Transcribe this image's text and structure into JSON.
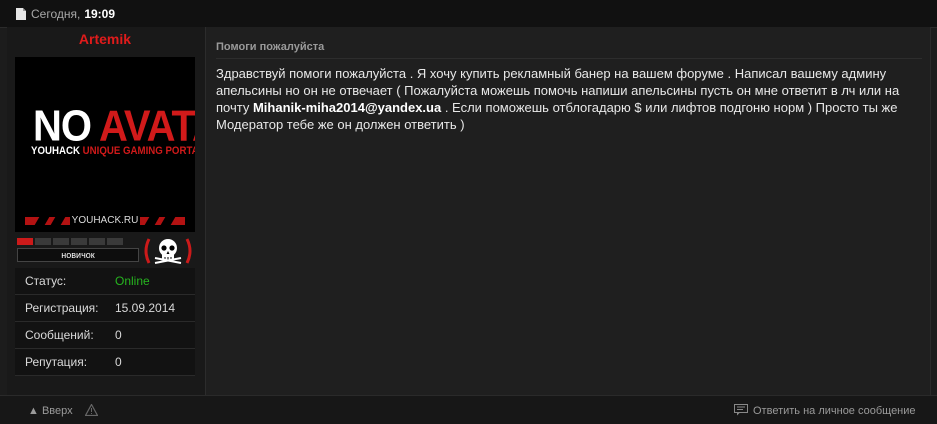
{
  "header": {
    "date_label": "Сегодня,",
    "time": "19:09",
    "doc_icon": "document-icon"
  },
  "author": {
    "username": "Artemik",
    "avatar": {
      "line1_white": "NO",
      "line1_red": "AVATAR",
      "subtitle_white": "YOUHACK",
      "subtitle_red": "UNIQUE GAMING PORTAL",
      "site": "YOUHACK.RU"
    },
    "rank": {
      "label": "новичок",
      "level_segments_filled": 1,
      "level_segments_total": 6,
      "badge_icon": "skull-icon"
    },
    "stats": [
      {
        "label": "Статус:",
        "value": "Online"
      },
      {
        "label": "Регистрация:",
        "value": "15.09.2014"
      },
      {
        "label": "Сообщений:",
        "value": "0"
      },
      {
        "label": "Репутация:",
        "value": "0"
      }
    ]
  },
  "post": {
    "title": "Помоги пожалуйста",
    "body_part1": "Здравствуй помоги пожалуйста . Я хочу купить рекламный банер на вашем форуме . Написал вашему админу апельсины но он не отвечает ( Пожалуйста можешь помочь напиши апельсины пусть он мне ответит в лч или на почту ",
    "email": "Mihanik-miha2014@yandex.ua",
    "body_part2": " . Если поможешь отблогадарю $ или лифтов подгоню норм ) Просто ты же Модератор тебе же он должен ответить )"
  },
  "footer": {
    "up_label": "▲ Вверх",
    "warn_icon": "warning-icon",
    "reply_icon": "reply-icon",
    "reply_label": "Ответить на личное сообщение"
  },
  "colors": {
    "username": "#e01b1b",
    "online": "#26b51f",
    "accent_red": "#cc1a1a"
  }
}
